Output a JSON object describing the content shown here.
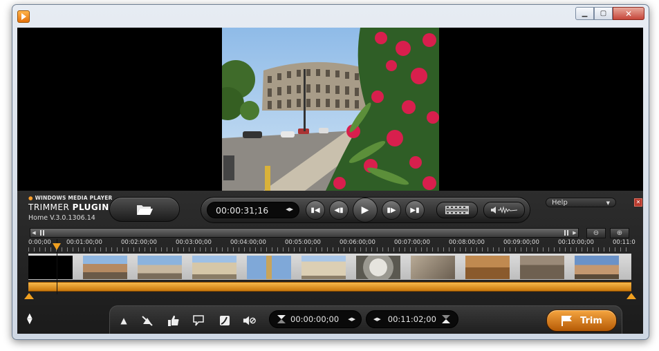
{
  "window": {
    "min_glyph": "▁",
    "max_glyph": "▢",
    "close_glyph": "✕"
  },
  "brand": {
    "line1": "WINDOWS MEDIA PLAYER",
    "line2_a": "TRIMMER",
    "line2_b": "PLUGIN",
    "version": "Home V.3.0.1306.14"
  },
  "transport": {
    "current_time": "00:00:31;16",
    "spin_glyph": "◀▶"
  },
  "help": {
    "label": "Help",
    "arrow": "▼"
  },
  "close_panel_glyph": "✕",
  "timeline": {
    "ticks": [
      "0:00;00",
      "00:01:00;00",
      "00:02:00;00",
      "00:03:00;00",
      "00:04:00;00",
      "00:05:00;00",
      "00:06:00;00",
      "00:07:00;00",
      "00:08:00;00",
      "00:09:00;00",
      "00:10:00;00",
      "00:11:0"
    ],
    "playhead_position_s": 31.5
  },
  "trim": {
    "start_time": "00:00:00;00",
    "end_time": "00:11:02;00",
    "button_label": "Trim"
  },
  "colors": {
    "accent_orange": "#f0a020",
    "dark_bg": "#1b1b1b"
  }
}
